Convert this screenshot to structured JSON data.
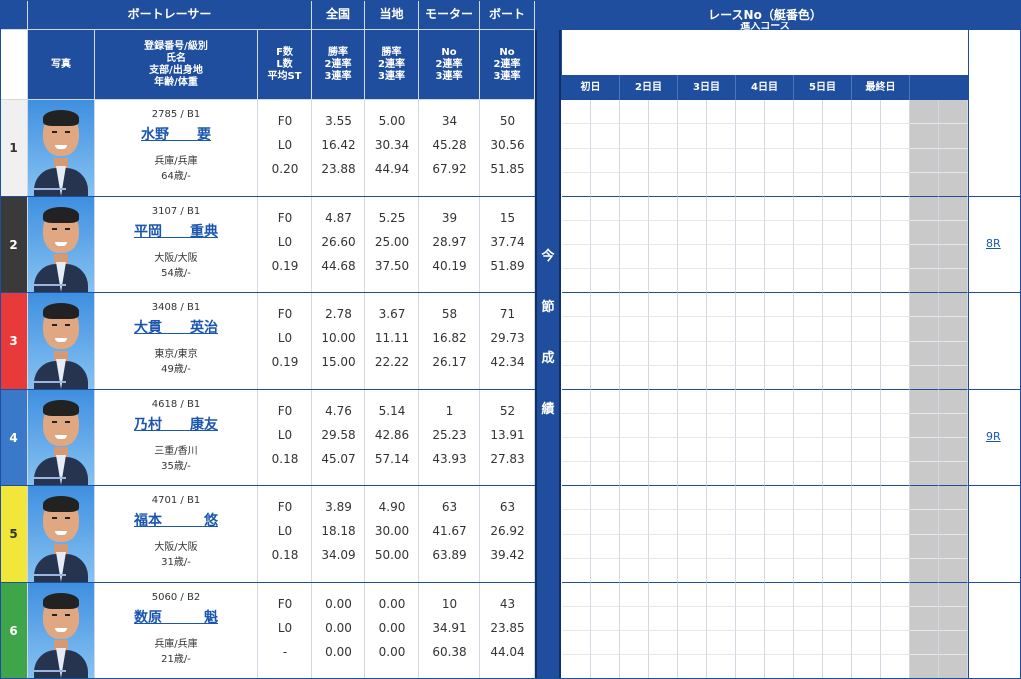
{
  "header": {
    "racer": "ボートレーサー",
    "zenkoku": "全国",
    "touchi": "当地",
    "motor": "モーター",
    "boat": "ボート",
    "photo": "写真",
    "info_lines": [
      "登録番号/級別",
      "氏名",
      "支部/出身地",
      "年齢/体重"
    ],
    "f_lines": [
      "F数",
      "L数",
      "平均ST"
    ],
    "rate_lines": [
      "勝率",
      "2連率",
      "3連率"
    ],
    "motor_lines": [
      "No",
      "2連率",
      "3連率"
    ],
    "boat_lines": [
      "No",
      "2連率",
      "3連率"
    ],
    "race_title": "レースNo（艇番色）",
    "race_sub": "進入コース",
    "days": [
      "初日",
      "2日目",
      "3日目",
      "4日目",
      "5日目",
      "最終日"
    ]
  },
  "vertical_label": [
    "今",
    "節",
    "成",
    "績"
  ],
  "colors": {
    "header_blue": "#1f4e9e",
    "lane": [
      "#f0f0f0",
      "#3a3a3a",
      "#e8393b",
      "#3a78c9",
      "#f3e63a",
      "#3fa54a"
    ],
    "lane_text": [
      "#333333",
      "#ffffff",
      "#ffffff",
      "#ffffff",
      "#333333",
      "#ffffff"
    ]
  },
  "racers": [
    {
      "lane": "1",
      "reg": "2785 / B1",
      "name": "水野　　要",
      "branch": "兵庫/兵庫",
      "age": "64歳/-",
      "f": [
        "F0",
        "L0",
        "0.20"
      ],
      "zenkoku": [
        "3.55",
        "16.42",
        "23.88"
      ],
      "touchi": [
        "5.00",
        "30.34",
        "44.94"
      ],
      "motor": [
        "34",
        "45.28",
        "67.92"
      ],
      "boat": [
        "50",
        "30.56",
        "51.85"
      ],
      "race_link": ""
    },
    {
      "lane": "2",
      "reg": "3107 / B1",
      "name": "平岡　　重典",
      "branch": "大阪/大阪",
      "age": "54歳/-",
      "f": [
        "F0",
        "L0",
        "0.19"
      ],
      "zenkoku": [
        "4.87",
        "26.60",
        "44.68"
      ],
      "touchi": [
        "5.25",
        "25.00",
        "37.50"
      ],
      "motor": [
        "39",
        "28.97",
        "40.19"
      ],
      "boat": [
        "15",
        "37.74",
        "51.89"
      ],
      "race_link": "8R"
    },
    {
      "lane": "3",
      "reg": "3408 / B1",
      "name": "大貫　　英治",
      "branch": "東京/東京",
      "age": "49歳/-",
      "f": [
        "F0",
        "L0",
        "0.19"
      ],
      "zenkoku": [
        "2.78",
        "10.00",
        "15.00"
      ],
      "touchi": [
        "3.67",
        "11.11",
        "22.22"
      ],
      "motor": [
        "58",
        "16.82",
        "26.17"
      ],
      "boat": [
        "71",
        "29.73",
        "42.34"
      ],
      "race_link": ""
    },
    {
      "lane": "4",
      "reg": "4618 / B1",
      "name": "乃村　　康友",
      "branch": "三重/香川",
      "age": "35歳/-",
      "f": [
        "F0",
        "L0",
        "0.18"
      ],
      "zenkoku": [
        "4.76",
        "29.58",
        "45.07"
      ],
      "touchi": [
        "5.14",
        "42.86",
        "57.14"
      ],
      "motor": [
        "1",
        "25.23",
        "43.93"
      ],
      "boat": [
        "52",
        "13.91",
        "27.83"
      ],
      "race_link": "9R"
    },
    {
      "lane": "5",
      "reg": "4701 / B1",
      "name": "福本　　　悠",
      "branch": "大阪/大阪",
      "age": "31歳/-",
      "f": [
        "F0",
        "L0",
        "0.18"
      ],
      "zenkoku": [
        "3.89",
        "18.18",
        "34.09"
      ],
      "touchi": [
        "4.90",
        "30.00",
        "50.00"
      ],
      "motor": [
        "63",
        "41.67",
        "63.89"
      ],
      "boat": [
        "63",
        "26.92",
        "39.42"
      ],
      "race_link": ""
    },
    {
      "lane": "6",
      "reg": "5060 / B2",
      "name": "数原　　　魁",
      "branch": "兵庫/兵庫",
      "age": "21歳/-",
      "f": [
        "F0",
        "L0",
        "-"
      ],
      "zenkoku": [
        "0.00",
        "0.00",
        "0.00"
      ],
      "touchi": [
        "0.00",
        "0.00",
        "0.00"
      ],
      "motor": [
        "10",
        "34.91",
        "60.38"
      ],
      "boat": [
        "43",
        "23.85",
        "44.04"
      ],
      "race_link": ""
    }
  ]
}
